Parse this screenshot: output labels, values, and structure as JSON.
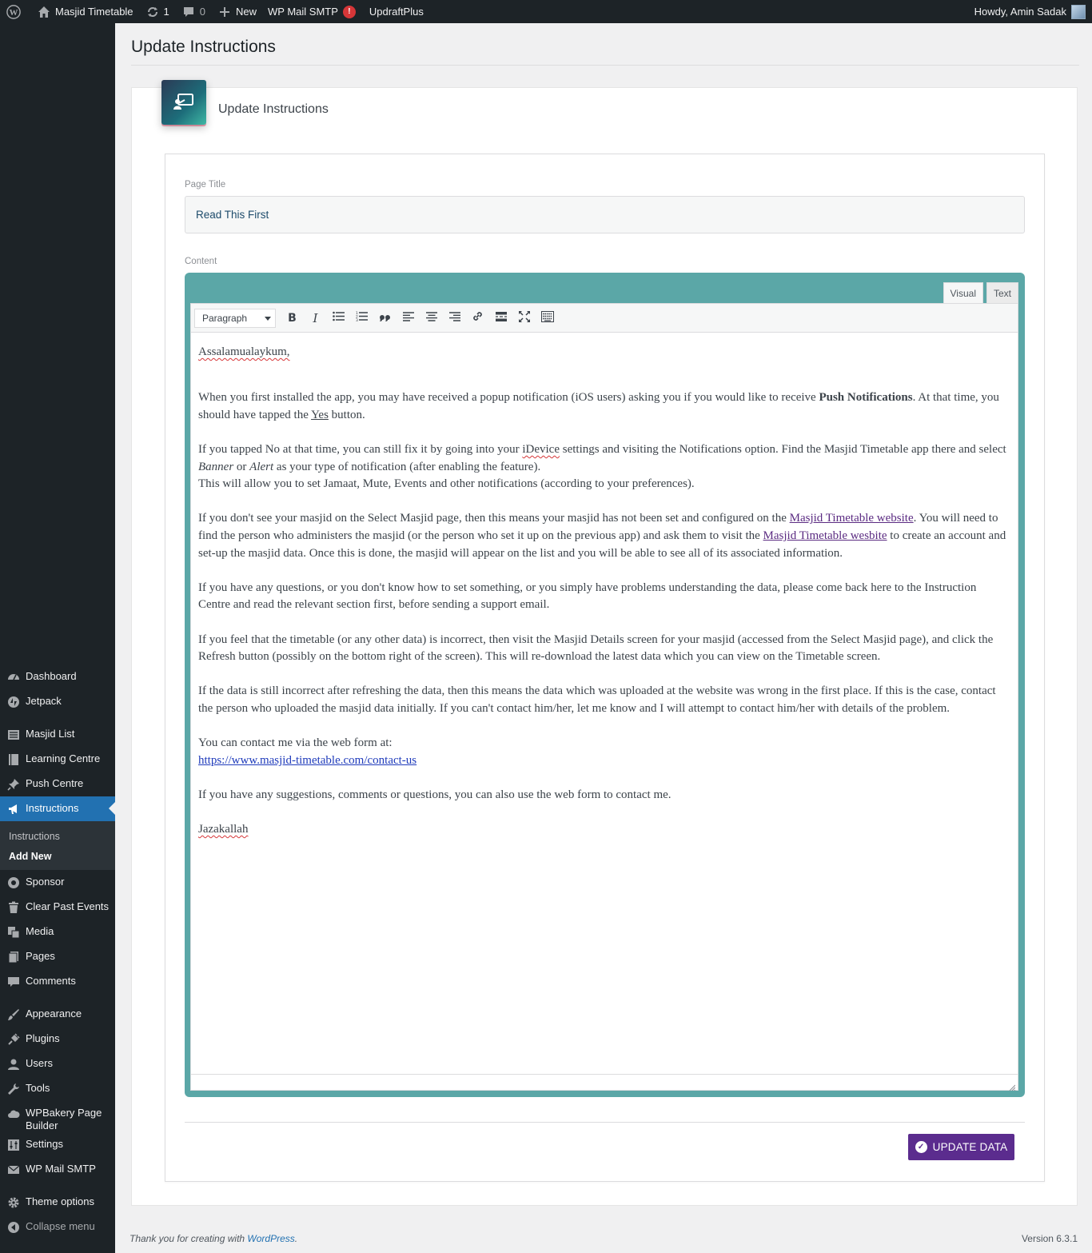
{
  "adminbar": {
    "site_name": "Masjid Timetable",
    "updates_count": "1",
    "comments_count": "0",
    "new_label": "New",
    "wp_mail_smtp": "WP Mail SMTP",
    "wp_mail_smtp_badge": "!",
    "updraftplus": "UpdraftPlus",
    "howdy": "Howdy, Amin Sadak"
  },
  "sidebar": {
    "dashboard": "Dashboard",
    "jetpack": "Jetpack",
    "masjid_list": "Masjid List",
    "learning_centre": "Learning Centre",
    "push_centre": "Push Centre",
    "instructions": "Instructions",
    "sub_instructions": "Instructions",
    "sub_add_new": "Add New",
    "sponsor": "Sponsor",
    "clear_past_events": "Clear Past Events",
    "media": "Media",
    "pages": "Pages",
    "comments": "Comments",
    "appearance": "Appearance",
    "plugins": "Plugins",
    "users": "Users",
    "tools": "Tools",
    "wpbakery_line1": "WPBakery Page",
    "wpbakery_line2": "Builder",
    "settings": "Settings",
    "wp_mail_smtp": "WP Mail SMTP",
    "theme_options": "Theme options",
    "collapse_menu": "Collapse menu"
  },
  "page": {
    "title": "Update Instructions",
    "card_title": "Update Instructions",
    "page_title_label": "Page Title",
    "page_title_value": "Read This First",
    "content_label": "Content",
    "tab_visual": "Visual",
    "tab_text": "Text",
    "format_select": "Paragraph",
    "update_button": "UPDATE DATA"
  },
  "content": {
    "p1": "Assalamualaykum,",
    "p2a": "When you first installed the app, you may have received a popup notification (iOS users) asking you if you would like to receive ",
    "p2b": "Push Notifications",
    "p2c": ". At that time, you should have tapped the ",
    "p2d": "Yes",
    "p2e": " button.",
    "p3a": "If you tapped No at that time, you can still fix it by going into your ",
    "p3b": "iDevice",
    "p3c": " settings and visiting the Notifications option. Find the Masjid Timetable app there and select ",
    "p3d": "Banner",
    "p3e": " or ",
    "p3f": "Alert",
    "p3g": " as your type of notification (after enabling the feature).",
    "p3h": "This will allow you to set Jamaat, Mute, Events and other notifications (according to your preferences).",
    "p4a": "If you don't see your masjid on the Select Masjid page, then this means your masjid has not been set and configured on the ",
    "p4b": "Masjid Timetable website",
    "p4c": ". You will need to find the person who administers the masjid (or the person who set it up on the previous app) and ask them to visit the ",
    "p4d": "Masjid Timetable wesbite",
    "p4e": " to create an account and set-up the masjid data. Once this is done, the masjid will appear on the list and you will be able to see all of its associated information.",
    "p5": "If you have any questions, or you don't know how to set something, or you simply have problems understanding the data, please come back here to the Instruction Centre and read the relevant section first, before sending a support email.",
    "p6": "If you feel that the timetable (or any other data) is incorrect, then visit the Masjid Details screen for your masjid (accessed from the Select Masjid page), and click the Refresh button (possibly on the bottom right of the screen). This will re-download the latest data which you can view on the Timetable screen.",
    "p7": "If the data is still incorrect after refreshing the data, then this means the data which was uploaded at the website was wrong in the first place. If this is the case, contact the person who uploaded the masjid data initially. If you can't contact him/her, let me know and I will attempt to contact him/her with details of the problem.",
    "p8a": "You can contact me via the web form at:",
    "p8b": "https://www.masjid-timetable.com/contact-us",
    "p9": "If you have any suggestions, comments or questions, you can also use the web form to contact me.",
    "p10": "Jazakallah"
  },
  "footer": {
    "thanks_prefix": "Thank you for creating with ",
    "wordpress_link": "WordPress",
    "thanks_suffix": ".",
    "version": "Version 6.3.1"
  }
}
